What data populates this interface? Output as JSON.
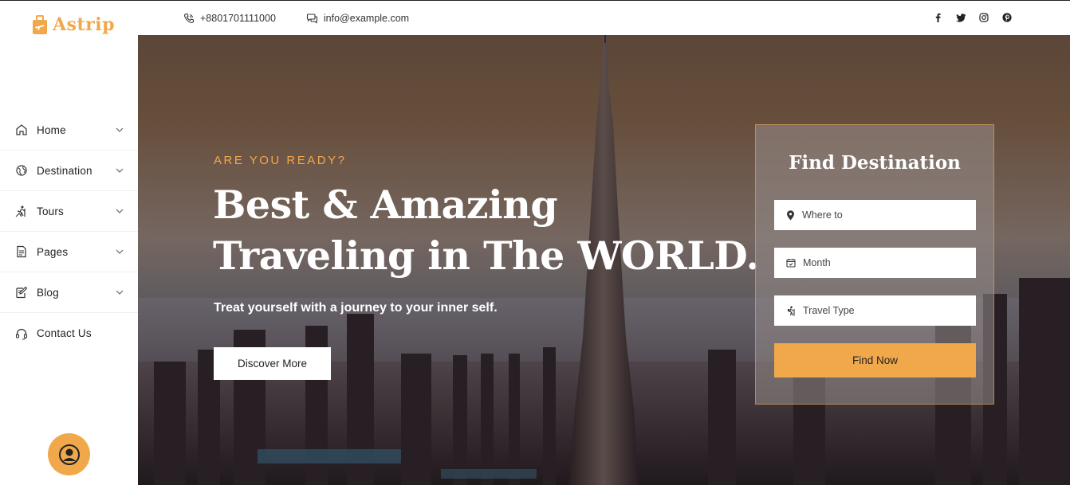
{
  "brand": {
    "name": "Astrip",
    "accent": "#f1a84a"
  },
  "topbar": {
    "phone": "+8801701111000",
    "email": "info@example.com",
    "socials": [
      "facebook-icon",
      "twitter-icon",
      "instagram-icon",
      "pinterest-icon"
    ]
  },
  "sidebar": {
    "items": [
      {
        "label": "Home",
        "icon": "home-icon",
        "has_dropdown": true
      },
      {
        "label": "Destination",
        "icon": "globe-icon",
        "has_dropdown": true
      },
      {
        "label": "Tours",
        "icon": "hiking-icon",
        "has_dropdown": true
      },
      {
        "label": "Pages",
        "icon": "document-icon",
        "has_dropdown": true
      },
      {
        "label": "Blog",
        "icon": "edit-icon",
        "has_dropdown": true
      },
      {
        "label": "Contact Us",
        "icon": "headset-icon",
        "has_dropdown": false
      }
    ]
  },
  "hero": {
    "eyebrow": "ARE YOU READY?",
    "headline_line1": "Best & Amazing",
    "headline_line2": "Traveling in The WORLD.",
    "tagline": "Treat yourself with a journey to your inner self.",
    "cta": "Discover More"
  },
  "finder": {
    "title": "Find Destination",
    "where_placeholder": "Where to",
    "month_placeholder": "Month",
    "type_placeholder": "Travel Type",
    "submit": "Find Now"
  }
}
